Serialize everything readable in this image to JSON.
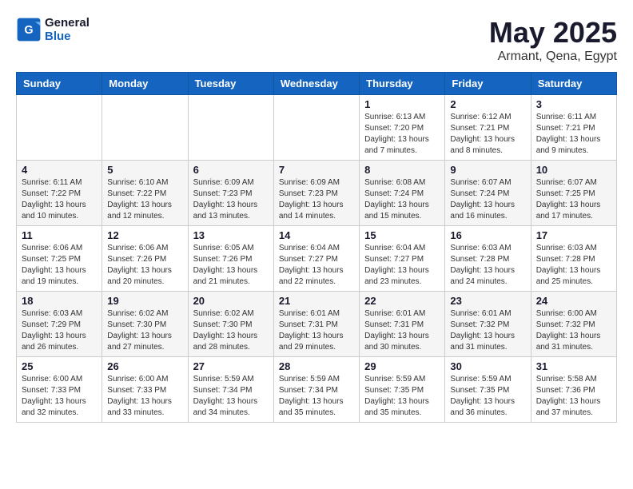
{
  "header": {
    "logo_line1": "General",
    "logo_line2": "Blue",
    "month": "May 2025",
    "location": "Armant, Qena, Egypt"
  },
  "weekdays": [
    "Sunday",
    "Monday",
    "Tuesday",
    "Wednesday",
    "Thursday",
    "Friday",
    "Saturday"
  ],
  "weeks": [
    [
      {
        "day": "",
        "info": ""
      },
      {
        "day": "",
        "info": ""
      },
      {
        "day": "",
        "info": ""
      },
      {
        "day": "",
        "info": ""
      },
      {
        "day": "1",
        "info": "Sunrise: 6:13 AM\nSunset: 7:20 PM\nDaylight: 13 hours\nand 7 minutes."
      },
      {
        "day": "2",
        "info": "Sunrise: 6:12 AM\nSunset: 7:21 PM\nDaylight: 13 hours\nand 8 minutes."
      },
      {
        "day": "3",
        "info": "Sunrise: 6:11 AM\nSunset: 7:21 PM\nDaylight: 13 hours\nand 9 minutes."
      }
    ],
    [
      {
        "day": "4",
        "info": "Sunrise: 6:11 AM\nSunset: 7:22 PM\nDaylight: 13 hours\nand 10 minutes."
      },
      {
        "day": "5",
        "info": "Sunrise: 6:10 AM\nSunset: 7:22 PM\nDaylight: 13 hours\nand 12 minutes."
      },
      {
        "day": "6",
        "info": "Sunrise: 6:09 AM\nSunset: 7:23 PM\nDaylight: 13 hours\nand 13 minutes."
      },
      {
        "day": "7",
        "info": "Sunrise: 6:09 AM\nSunset: 7:23 PM\nDaylight: 13 hours\nand 14 minutes."
      },
      {
        "day": "8",
        "info": "Sunrise: 6:08 AM\nSunset: 7:24 PM\nDaylight: 13 hours\nand 15 minutes."
      },
      {
        "day": "9",
        "info": "Sunrise: 6:07 AM\nSunset: 7:24 PM\nDaylight: 13 hours\nand 16 minutes."
      },
      {
        "day": "10",
        "info": "Sunrise: 6:07 AM\nSunset: 7:25 PM\nDaylight: 13 hours\nand 17 minutes."
      }
    ],
    [
      {
        "day": "11",
        "info": "Sunrise: 6:06 AM\nSunset: 7:25 PM\nDaylight: 13 hours\nand 19 minutes."
      },
      {
        "day": "12",
        "info": "Sunrise: 6:06 AM\nSunset: 7:26 PM\nDaylight: 13 hours\nand 20 minutes."
      },
      {
        "day": "13",
        "info": "Sunrise: 6:05 AM\nSunset: 7:26 PM\nDaylight: 13 hours\nand 21 minutes."
      },
      {
        "day": "14",
        "info": "Sunrise: 6:04 AM\nSunset: 7:27 PM\nDaylight: 13 hours\nand 22 minutes."
      },
      {
        "day": "15",
        "info": "Sunrise: 6:04 AM\nSunset: 7:27 PM\nDaylight: 13 hours\nand 23 minutes."
      },
      {
        "day": "16",
        "info": "Sunrise: 6:03 AM\nSunset: 7:28 PM\nDaylight: 13 hours\nand 24 minutes."
      },
      {
        "day": "17",
        "info": "Sunrise: 6:03 AM\nSunset: 7:28 PM\nDaylight: 13 hours\nand 25 minutes."
      }
    ],
    [
      {
        "day": "18",
        "info": "Sunrise: 6:03 AM\nSunset: 7:29 PM\nDaylight: 13 hours\nand 26 minutes."
      },
      {
        "day": "19",
        "info": "Sunrise: 6:02 AM\nSunset: 7:30 PM\nDaylight: 13 hours\nand 27 minutes."
      },
      {
        "day": "20",
        "info": "Sunrise: 6:02 AM\nSunset: 7:30 PM\nDaylight: 13 hours\nand 28 minutes."
      },
      {
        "day": "21",
        "info": "Sunrise: 6:01 AM\nSunset: 7:31 PM\nDaylight: 13 hours\nand 29 minutes."
      },
      {
        "day": "22",
        "info": "Sunrise: 6:01 AM\nSunset: 7:31 PM\nDaylight: 13 hours\nand 30 minutes."
      },
      {
        "day": "23",
        "info": "Sunrise: 6:01 AM\nSunset: 7:32 PM\nDaylight: 13 hours\nand 31 minutes."
      },
      {
        "day": "24",
        "info": "Sunrise: 6:00 AM\nSunset: 7:32 PM\nDaylight: 13 hours\nand 31 minutes."
      }
    ],
    [
      {
        "day": "25",
        "info": "Sunrise: 6:00 AM\nSunset: 7:33 PM\nDaylight: 13 hours\nand 32 minutes."
      },
      {
        "day": "26",
        "info": "Sunrise: 6:00 AM\nSunset: 7:33 PM\nDaylight: 13 hours\nand 33 minutes."
      },
      {
        "day": "27",
        "info": "Sunrise: 5:59 AM\nSunset: 7:34 PM\nDaylight: 13 hours\nand 34 minutes."
      },
      {
        "day": "28",
        "info": "Sunrise: 5:59 AM\nSunset: 7:34 PM\nDaylight: 13 hours\nand 35 minutes."
      },
      {
        "day": "29",
        "info": "Sunrise: 5:59 AM\nSunset: 7:35 PM\nDaylight: 13 hours\nand 35 minutes."
      },
      {
        "day": "30",
        "info": "Sunrise: 5:59 AM\nSunset: 7:35 PM\nDaylight: 13 hours\nand 36 minutes."
      },
      {
        "day": "31",
        "info": "Sunrise: 5:58 AM\nSunset: 7:36 PM\nDaylight: 13 hours\nand 37 minutes."
      }
    ]
  ]
}
